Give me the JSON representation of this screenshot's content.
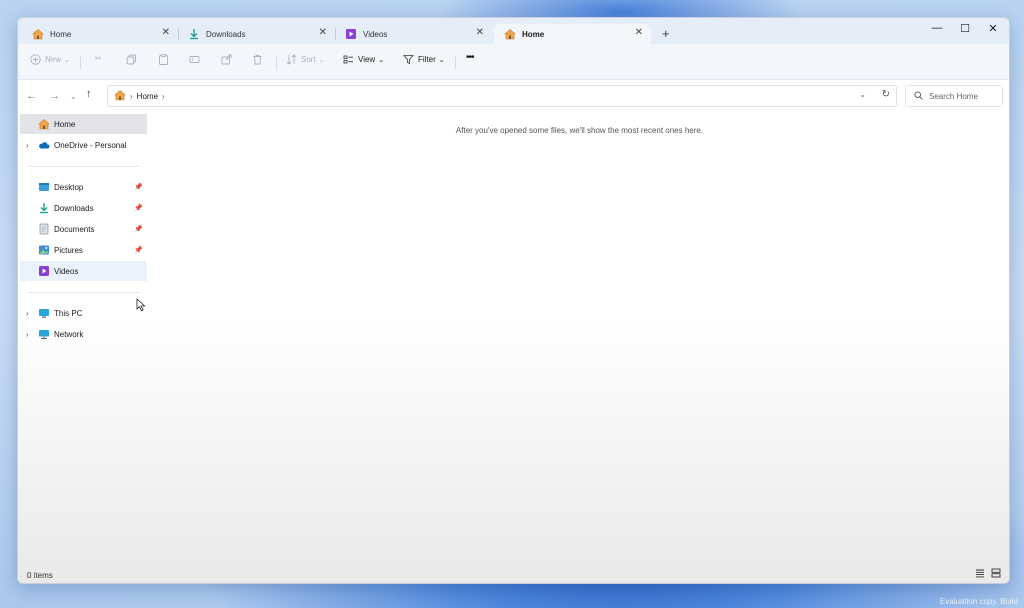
{
  "tabs": [
    {
      "label": "Home",
      "icon": "home-icon",
      "active": false
    },
    {
      "label": "Downloads",
      "icon": "download-icon",
      "active": false
    },
    {
      "label": "Videos",
      "icon": "videos-icon",
      "active": false
    },
    {
      "label": "Home",
      "icon": "home-icon",
      "active": true
    }
  ],
  "window_controls": {
    "minimize": "—",
    "maximize": "☐",
    "close": "✕"
  },
  "toolbar": {
    "new_label": "New",
    "sort_label": "Sort",
    "view_label": "View",
    "filter_label": "Filter",
    "more_label": "•••"
  },
  "address": {
    "crumb": "Home",
    "separator": "›"
  },
  "search": {
    "placeholder": "Search Home"
  },
  "sidebar": {
    "items": [
      {
        "label": "Home",
        "icon": "home-icon"
      },
      {
        "label": "OneDrive - Personal",
        "icon": "cloud-icon"
      },
      {
        "label": "Desktop",
        "icon": "desktop-icon",
        "pinned": true
      },
      {
        "label": "Downloads",
        "icon": "download-icon",
        "pinned": true
      },
      {
        "label": "Documents",
        "icon": "document-icon",
        "pinned": true
      },
      {
        "label": "Pictures",
        "icon": "pictures-icon",
        "pinned": true
      },
      {
        "label": "Videos",
        "icon": "videos-icon"
      },
      {
        "label": "This PC",
        "icon": "pc-icon"
      },
      {
        "label": "Network",
        "icon": "network-icon"
      }
    ]
  },
  "main": {
    "empty_message": "After you've opened some files, we'll show the most recent ones here."
  },
  "status": {
    "items_count": "0 items"
  },
  "watermark": "Evaluation copy. Build",
  "colors": {
    "accent": "#0067c0",
    "home_icon": "#e08a2c",
    "videos_icon": "#8a3fd1",
    "onedrive_icon": "#0f6cbd"
  }
}
